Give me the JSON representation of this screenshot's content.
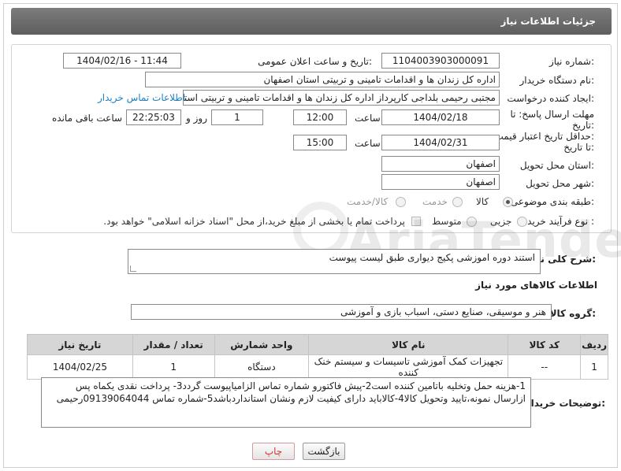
{
  "header": {
    "title": "جزئیات اطلاعات نیاز"
  },
  "form": {
    "need_number": {
      "label": "شماره نیاز:",
      "value": "1104003903000091"
    },
    "announce": {
      "label": "تاریخ و ساعت اعلان عمومی:",
      "value": "1404/02/16 - 11:44"
    },
    "buyer": {
      "label": "نام دستگاه خریدار:",
      "value": "اداره کل زندان ها و اقدامات تامینی و تربیتی استان اصفهان"
    },
    "creator": {
      "label": "ایجاد کننده درخواست:",
      "value": "مجتبی رحیمی بلداجی کارپرداز اداره کل زندان ها و اقدامات تامینی و تربیتی استا",
      "contact_link": "اطلاعات تماس خریدار"
    },
    "deadline": {
      "label_line1": "مهلت ارسال پاسخ: تا",
      "label_line2": "تاریخ:",
      "date": "1404/02/18",
      "time_label": "ساعت",
      "time": "12:00",
      "days": "1",
      "days_label": "روز و",
      "remaining": "22:25:03",
      "remaining_label": "ساعت باقی مانده"
    },
    "validity": {
      "label_line1": "حداقل تاریخ اعتبار قیمت:",
      "label_line2": "تا تاریخ:",
      "date": "1404/02/31",
      "time_label": "ساعت",
      "time": "15:00"
    },
    "province": {
      "label": "استان محل تحویل:",
      "value": "اصفهان"
    },
    "city": {
      "label": "شهر محل تحویل:",
      "value": "اصفهان"
    },
    "category": {
      "label": "طبقه بندی موضوعی:",
      "options": [
        "کالا",
        "خدمت",
        "کالا/خدمت"
      ],
      "selected": "کالا"
    },
    "process": {
      "label": "نوع فرآیند خرید :",
      "options": [
        "جزیی",
        "متوسط"
      ],
      "note": "پرداخت تمام یا بخشی از مبلغ خرید،از محل \"اسناد خزانه اسلامی\" خواهد بود."
    }
  },
  "description": {
    "label": "شرح کلی نیاز:",
    "value": "استند  دوره اموزشی پکیج دیواری  طبق لیست پیوست"
  },
  "goods_section": {
    "title": "اطلاعات کالاهای مورد نیاز",
    "group_label": "گروه کالا:",
    "group_value": "هنر و موسیقی، صنایع دستی، اسباب بازی و آموزشی"
  },
  "table": {
    "headers": [
      "ردیف",
      "کد کالا",
      "نام کالا",
      "واحد شمارش",
      "تعداد / مقدار",
      "تاریخ نیاز"
    ],
    "rows": [
      [
        "1",
        "--",
        "تجهیزات کمک آموزشی تاسیسات و سیستم خنک کننده",
        "دستگاه",
        "1",
        "1404/02/25"
      ]
    ]
  },
  "buyer_notes": {
    "label": "توضیحات خریدار:",
    "value": "1-هزینه حمل وتخلیه باتامین کننده است2-پیش فاکتورو شماره تماس الزامیاپیوست گردد3- پرداخت نقدی یکماه  پس ازارسال نمونه،تایید وتحویل کالا4-کالاباید دارای کیفیت لازم ونشان استانداردباشد5-شماره تماس 09139064044رحیمی"
  },
  "buttons": {
    "back": "بازگشت",
    "print": "چاپ"
  },
  "watermark": "AriaTender.neT"
}
